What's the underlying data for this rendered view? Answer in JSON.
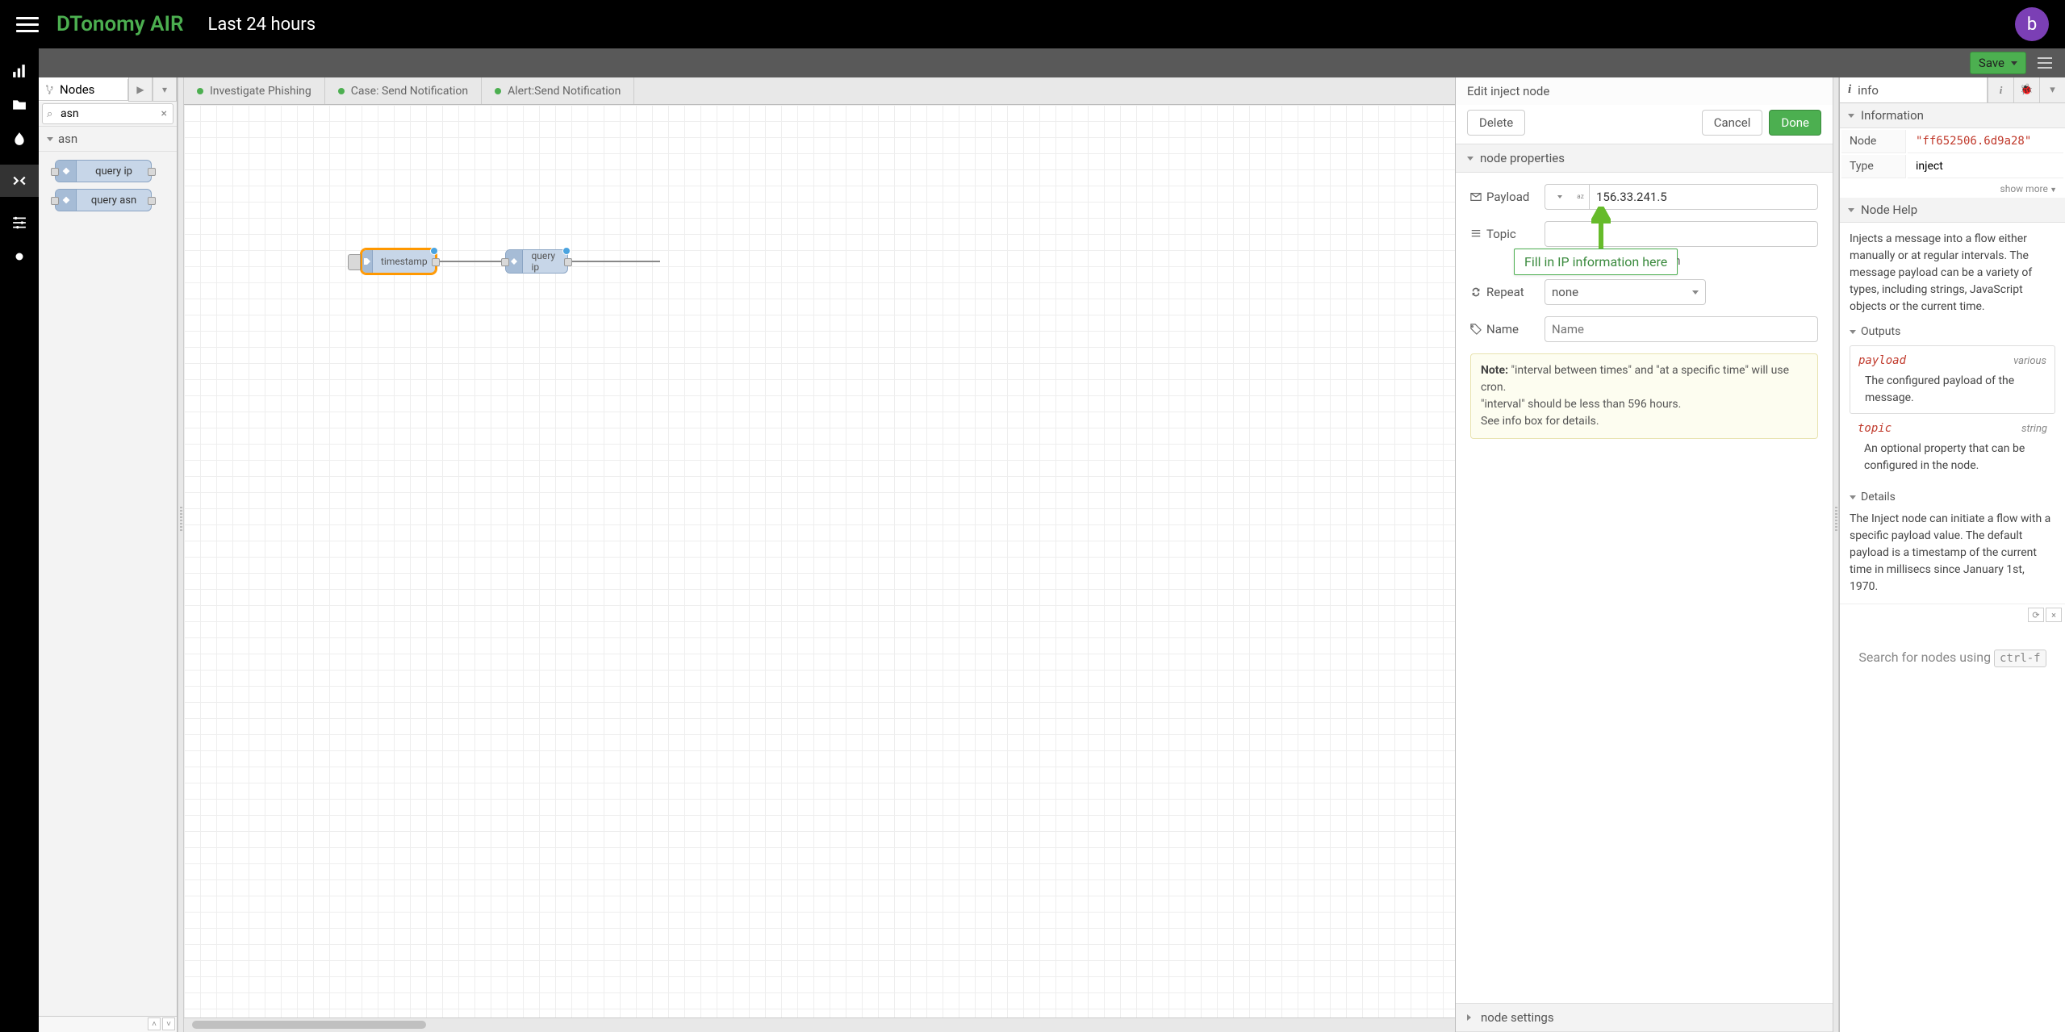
{
  "header": {
    "brand": "DTonomy AIR",
    "timerange": "Last 24 hours",
    "avatar_initial": "b"
  },
  "toolbar": {
    "save_label": "Save"
  },
  "palette": {
    "title": "Nodes",
    "search_value": "asn",
    "category": "asn",
    "items": [
      {
        "label": "query ip"
      },
      {
        "label": "query asn"
      }
    ]
  },
  "tabs": [
    {
      "label": "Investigate Phishing"
    },
    {
      "label": "Case: Send Notification"
    },
    {
      "label": "Alert:Send Notification"
    }
  ],
  "flow_nodes": {
    "timestamp": {
      "label": "timestamp"
    },
    "query_ip": {
      "label": "query ip"
    }
  },
  "edit_panel": {
    "title": "Edit inject node",
    "delete_label": "Delete",
    "cancel_label": "Cancel",
    "done_label": "Done",
    "section_properties": "node properties",
    "section_settings": "node settings",
    "payload_label": "Payload",
    "payload_value": "156.33.241.5",
    "topic_label": "Topic",
    "topic_value": "",
    "truncated_tail": "nds, then",
    "repeat_label": "Repeat",
    "repeat_value": "none",
    "name_label": "Name",
    "name_placeholder": "Name",
    "note_bold": "Note:",
    "note_line1": " \"interval between times\" and \"at a specific time\" will use cron.",
    "note_line2": "\"interval\" should be less than 596 hours.",
    "note_line3": "See info box for details.",
    "annotation_text": "Fill in IP information here"
  },
  "sidebar": {
    "tab_label": "info",
    "section_information": "Information",
    "info_rows": {
      "node_label": "Node",
      "node_value": "\"ff652506.6d9a28\"",
      "type_label": "Type",
      "type_value": "inject"
    },
    "show_more": "show more",
    "section_help": "Node Help",
    "help_intro": "Injects a message into a flow either manually or at regular intervals. The message payload can be a variety of types, including strings, JavaScript objects or the current time.",
    "outputs_label": "Outputs",
    "outputs": [
      {
        "key": "payload",
        "type": "various",
        "desc": "The configured payload of the message."
      },
      {
        "key": "topic",
        "type": "string",
        "desc": "An optional property that can be configured in the node."
      }
    ],
    "details_label": "Details",
    "details_text": "The Inject node can initiate a flow with a specific payload value. The default payload is a timestamp of the current time in millisecs since January 1st, 1970.",
    "search_hint_prefix": "Search for nodes using ",
    "search_hint_kbd": "ctrl-f"
  }
}
